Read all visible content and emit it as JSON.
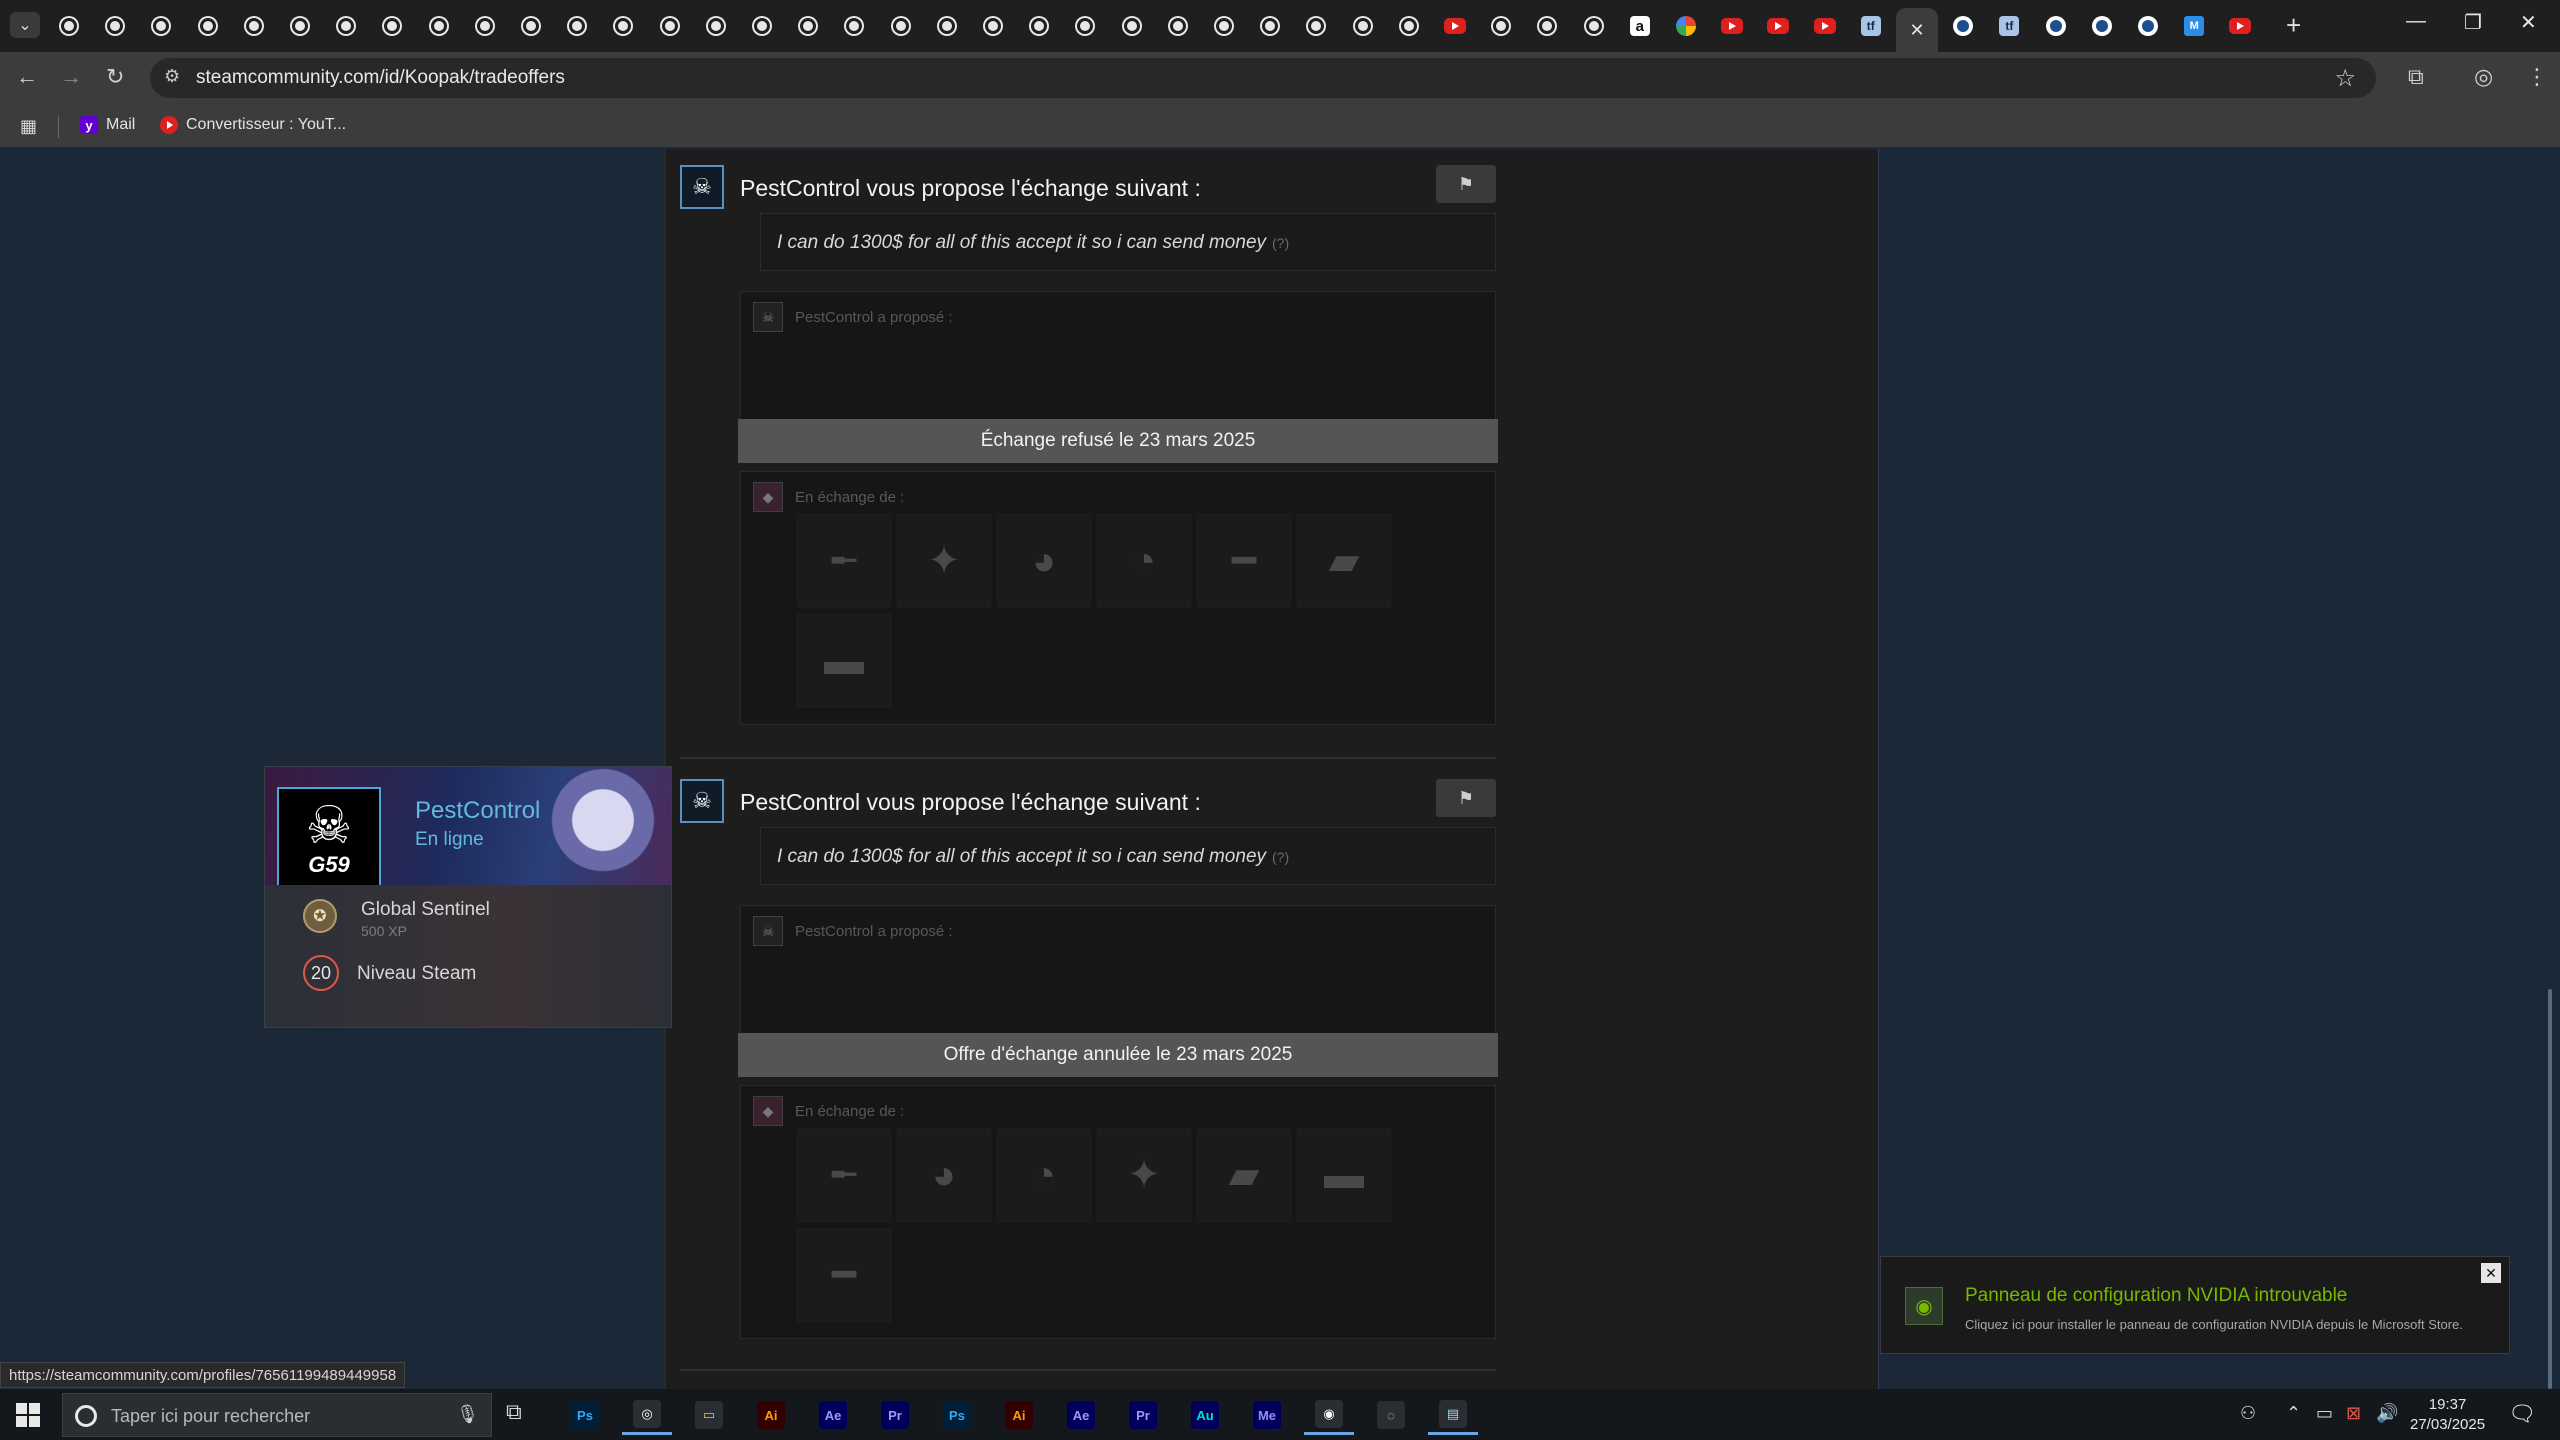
{
  "browser": {
    "url": "steamcommunity.com/id/Koopak/tradeoffers",
    "bookmarks": [
      {
        "label": "Mail",
        "icon": "yahoo-mail-icon"
      },
      {
        "label": "Convertisseur : YouT...",
        "icon": "youtube-icon"
      }
    ],
    "tabs": [
      {
        "favicon": "steamcommunity-icon"
      },
      {
        "favicon": "steamcommunity-icon"
      },
      {
        "favicon": "steamcommunity-icon"
      },
      {
        "favicon": "steamcommunity-icon"
      },
      {
        "favicon": "steamcommunity-icon"
      },
      {
        "favicon": "steamcommunity-icon"
      },
      {
        "favicon": "steamcommunity-icon"
      },
      {
        "favicon": "steamcommunity-icon"
      },
      {
        "favicon": "steamcommunity-icon"
      },
      {
        "favicon": "steamcommunity-icon"
      },
      {
        "favicon": "steamcommunity-icon"
      },
      {
        "favicon": "steamcommunity-icon"
      },
      {
        "favicon": "steamcommunity-icon"
      },
      {
        "favicon": "steamcommunity-icon"
      },
      {
        "favicon": "steamcommunity-icon"
      },
      {
        "favicon": "steamcommunity-icon"
      },
      {
        "favicon": "steamcommunity-icon"
      },
      {
        "favicon": "steamcommunity-icon"
      },
      {
        "favicon": "steamcommunity-icon"
      },
      {
        "favicon": "steamcommunity-icon"
      },
      {
        "favicon": "steamcommunity-icon"
      },
      {
        "favicon": "steamcommunity-icon"
      },
      {
        "favicon": "steamcommunity-icon"
      },
      {
        "favicon": "steamcommunity-icon"
      },
      {
        "favicon": "steamcommunity-icon"
      },
      {
        "favicon": "steamcommunity-icon"
      },
      {
        "favicon": "steamcommunity-icon"
      },
      {
        "favicon": "steamcommunity-icon"
      },
      {
        "favicon": "steamcommunity-icon"
      },
      {
        "favicon": "steamcommunity-icon"
      },
      {
        "favicon": "youtube-icon"
      },
      {
        "favicon": "steamcommunity-icon"
      },
      {
        "favicon": "steamcommunity-icon"
      },
      {
        "favicon": "steamcommunity-icon"
      },
      {
        "favicon": "amazon-icon"
      },
      {
        "favicon": "google-icon"
      },
      {
        "favicon": "youtube-icon"
      },
      {
        "favicon": "youtube-icon"
      },
      {
        "favicon": "youtube-icon"
      },
      {
        "favicon": "backpack-tf-icon"
      },
      {
        "favicon": "close-icon",
        "active": true
      },
      {
        "favicon": "steam-icon"
      },
      {
        "favicon": "backpack-tf-icon"
      },
      {
        "favicon": "steam-icon"
      },
      {
        "favicon": "steam-icon"
      },
      {
        "favicon": "steam-wrench-icon"
      },
      {
        "favicon": "marketplace-icon"
      },
      {
        "favicon": "youtube-icon"
      }
    ]
  },
  "offers": [
    {
      "partner": "PestControl",
      "title": "PestControl vous propose l'échange suivant :",
      "message": "I can do 1300$ for all of this accept it so i can send money",
      "message_hint": "(?)",
      "proposed_label": "PestControl a proposé :",
      "status": "Échange refusé le 23 mars 2025",
      "exchange_label": "En échange de :",
      "items": [
        {
          "icon": "rifle-icon"
        },
        {
          "icon": "festive-gun-icon"
        },
        {
          "icon": "pyro-hat-icon"
        },
        {
          "icon": "heavy-hat-icon"
        },
        {
          "icon": "sniper-rifle-icon"
        },
        {
          "icon": "festive-launcher-icon"
        },
        {
          "icon": "rocket-launcher-icon"
        }
      ]
    },
    {
      "partner": "PestControl",
      "title": "PestControl vous propose l'échange suivant :",
      "message": "I can do 1300$ for all of this accept it so i can send money",
      "message_hint": "(?)",
      "proposed_label": "PestControl a proposé :",
      "status": "Offre d'échange annulée le 23 mars 2025",
      "exchange_label": "En échange de :",
      "items": [
        {
          "icon": "rifle-icon"
        },
        {
          "icon": "pyro-hat-icon"
        },
        {
          "icon": "heavy-hat-icon"
        },
        {
          "icon": "festive-gun-icon"
        },
        {
          "icon": "festive-launcher-icon"
        },
        {
          "icon": "rocket-launcher-icon"
        },
        {
          "icon": "sniper-rifle-icon"
        }
      ]
    }
  ],
  "profile_card": {
    "name": "PestControl",
    "status": "En ligne",
    "avatar_text": "G59",
    "rank": "Global Sentinel",
    "xp": "500 XP",
    "level": "20",
    "level_label": "Niveau Steam"
  },
  "status_link": "https://steamcommunity.com/profiles/76561199489449958",
  "nvidia_notification": {
    "title": "Panneau de configuration NVIDIA introuvable",
    "text": "Cliquez ici pour installer le panneau de configuration NVIDIA depuis le Microsoft Store.",
    "accent": "#76b900"
  },
  "taskbar": {
    "search_placeholder": "Taper ici pour rechercher",
    "apps": [
      {
        "label": "Ps",
        "name": "photoshop-beta-icon",
        "color": "#31a8ff",
        "bg": "#001e36"
      },
      {
        "label": "◎",
        "name": "chrome-icon",
        "color": "#fff",
        "bg": "#2a2e33",
        "active": true
      },
      {
        "label": "▭",
        "name": "file-explorer-icon",
        "color": "#f5c542",
        "bg": "#2a2e33"
      },
      {
        "label": "Ai",
        "name": "illustrator-beta-icon",
        "color": "#ff9a00",
        "bg": "#330000"
      },
      {
        "label": "Ae",
        "name": "after-effects-beta-icon",
        "color": "#9999ff",
        "bg": "#00005b"
      },
      {
        "label": "Pr",
        "name": "premiere-beta-icon",
        "color": "#9999ff",
        "bg": "#00005b"
      },
      {
        "label": "Ps",
        "name": "photoshop-icon",
        "color": "#31a8ff",
        "bg": "#001e36"
      },
      {
        "label": "Ai",
        "name": "illustrator-icon",
        "color": "#ff9a00",
        "bg": "#330000"
      },
      {
        "label": "Ae",
        "name": "after-effects-icon",
        "color": "#9999ff",
        "bg": "#00005b"
      },
      {
        "label": "Pr",
        "name": "premiere-icon",
        "color": "#9999ff",
        "bg": "#00005b"
      },
      {
        "label": "Au",
        "name": "audition-icon",
        "color": "#00e4bb",
        "bg": "#00005b"
      },
      {
        "label": "Me",
        "name": "media-encoder-icon",
        "color": "#8f8fff",
        "bg": "#00005b"
      },
      {
        "label": "◉",
        "name": "steam-icon",
        "color": "#fff",
        "bg": "#2a2e33",
        "active": true
      },
      {
        "label": "◌",
        "name": "obs-icon",
        "color": "#ddd",
        "bg": "#2a2e33"
      },
      {
        "label": "▤",
        "name": "remote-desktop-icon",
        "color": "#9fd7e8",
        "bg": "#2a2e33",
        "active": true
      }
    ],
    "time": "19:37",
    "date": "27/03/2025",
    "notification_count": "1"
  }
}
